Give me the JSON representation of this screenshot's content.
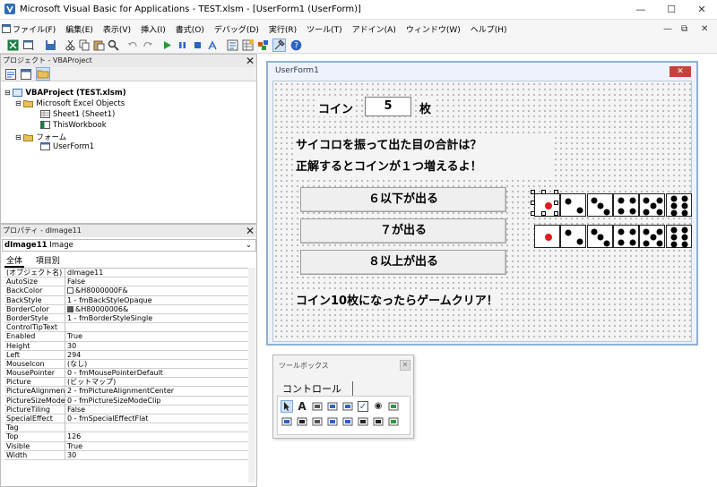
{
  "window": {
    "title": "Microsoft Visual Basic for Applications - TEST.xlsm - [UserForm1 (UserForm)]",
    "minimize": "—",
    "maximize": "☐",
    "close": "✕"
  },
  "menu": {
    "items": [
      "ファイル(F)",
      "編集(E)",
      "表示(V)",
      "挿入(I)",
      "書式(O)",
      "デバッグ(D)",
      "実行(R)",
      "ツール(T)",
      "アドイン(A)",
      "ウィンドウ(W)",
      "ヘルプ(H)"
    ],
    "mdi_minimize": "—",
    "mdi_restore": "⧉",
    "mdi_close": "✕"
  },
  "project_pane": {
    "title": "プロジェクト - VBAProject",
    "close": "✕",
    "tree": {
      "root": "VBAProject (TEST.xlsm)",
      "excel_objects": "Microsoft Excel Objects",
      "sheet1": "Sheet1 (Sheet1)",
      "workbook": "ThisWorkbook",
      "forms": "フォーム",
      "userform1": "UserForm1"
    }
  },
  "properties_pane": {
    "title": "プロパティ - dImage11",
    "close": "✕",
    "object_name": "dImage11",
    "object_type": "Image",
    "combo_arrow": "⌄",
    "tab_all": "全体",
    "tab_category": "項目別",
    "rows": [
      {
        "name": "(オブジェクト名)",
        "value": "dImage11"
      },
      {
        "name": "AutoSize",
        "value": "False"
      },
      {
        "name": "BackColor",
        "value": "&H8000000F&",
        "swatch": "#ffffff"
      },
      {
        "name": "BackStyle",
        "value": "1 - fmBackStyleOpaque"
      },
      {
        "name": "BorderColor",
        "value": "&H80000006&",
        "swatch": "#555555"
      },
      {
        "name": "BorderStyle",
        "value": "1 - fmBorderStyleSingle"
      },
      {
        "name": "ControlTipText",
        "value": ""
      },
      {
        "name": "Enabled",
        "value": "True"
      },
      {
        "name": "Height",
        "value": "30"
      },
      {
        "name": "Left",
        "value": "294"
      },
      {
        "name": "MouseIcon",
        "value": "(なし)"
      },
      {
        "name": "MousePointer",
        "value": "0 - fmMousePointerDefault"
      },
      {
        "name": "Picture",
        "value": "(ビットマップ)"
      },
      {
        "name": "PictureAlignment",
        "value": "2 - fmPictureAlignmentCenter"
      },
      {
        "name": "PictureSizeMode",
        "value": "0 - fmPictureSizeModeClip"
      },
      {
        "name": "PictureTiling",
        "value": "False"
      },
      {
        "name": "SpecialEffect",
        "value": "0 - fmSpecialEffectFlat"
      },
      {
        "name": "Tag",
        "value": ""
      },
      {
        "name": "Top",
        "value": "126"
      },
      {
        "name": "Visible",
        "value": "True"
      },
      {
        "name": "Width",
        "value": "30"
      }
    ]
  },
  "userform": {
    "title": "UserForm1",
    "close": "✕",
    "coin_label": "コイン",
    "coin_value": "5",
    "coin_unit": "枚",
    "question_line1": "サイコロを振って出た目の合計は？",
    "question_line2": "正解するとコインが１つ増えるよ！",
    "button_low": "６以下が出る",
    "button_seven": "７が出る",
    "button_high": "８以上が出る",
    "clear_message": "コイン10枚になったらゲームクリア！",
    "dice_rows": [
      [
        1,
        2,
        3,
        4,
        5,
        6
      ],
      [
        1,
        2,
        3,
        4,
        5,
        6
      ]
    ]
  },
  "toolbox": {
    "title": "ツールボックス",
    "close": "✕",
    "tab": "コントロール",
    "tools_row1": [
      "select-pointer-icon",
      "label-tool-icon",
      "textbox-tool-icon",
      "combobox-tool-icon",
      "listbox-tool-icon",
      "checkbox-tool-icon",
      "optionbutton-tool-icon",
      "togglebutton-tool-icon"
    ],
    "tools_row2": [
      "frame-tool-icon",
      "commandbutton-tool-icon",
      "tabstrip-tool-icon",
      "multipage-tool-icon",
      "scrollbar-tool-icon",
      "spinbutton-tool-icon",
      "image-tool-icon",
      "refedit-tool-icon"
    ],
    "label_glyph": "A",
    "checkbox_glyph": "✓",
    "option_glyph": "◉"
  },
  "colors": {
    "form_border": "#8fb0d4",
    "form_close": "#c7423a",
    "pip_red": "#e01b1b",
    "accent_blue": "#1f5fbf"
  }
}
